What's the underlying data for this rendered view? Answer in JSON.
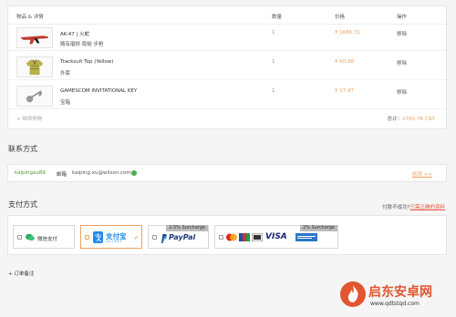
{
  "cart": {
    "headers": {
      "item": "物品 & 详情",
      "qty": "数量",
      "price": "价格",
      "action": "操作"
    },
    "items": [
      {
        "name": "AK-47 | 火蛇",
        "sub": "略有磨损 隐秘 步枪",
        "qty": "1",
        "price": "¥ 1686.31",
        "action": "移除",
        "icon": "ak47-rifle-icon"
      },
      {
        "name": "Tracksuit Top (Yellow)",
        "sub": "外套",
        "qty": "1",
        "price": "¥ 60.98",
        "action": "移除",
        "icon": "tracksuit-icon"
      },
      {
        "name": "GAMESCOM INVITATIONAL KEY",
        "sub": "宝箱",
        "qty": "1",
        "price": "¥ 17.47",
        "action": "移除",
        "icon": "key-icon"
      }
    ],
    "continue": "+ 继续购物",
    "total_label": "总计：",
    "total_amount": "1760.76 CNY"
  },
  "contact": {
    "title": "联系方式",
    "username": "kaipingxu89",
    "mail_label": "邮箱",
    "mail": "kaiping.xu@wilson.com",
    "edit": "修改 >>"
  },
  "payment": {
    "title": "支付方式",
    "note_prefix": "付款不成功?",
    "note_link": "只需正确的资料",
    "methods": [
      {
        "label": "微信支付",
        "icon": "wechat-icon",
        "surcharge": ""
      },
      {
        "label": "支付宝",
        "sub": "ALIPAY",
        "icon": "alipay-icon",
        "surcharge": ""
      },
      {
        "label": "PayPal",
        "icon": "paypal-icon",
        "surcharge": "2.5% Surcharge"
      },
      {
        "label": "VISA",
        "icon": "cards-icon",
        "surcharge": "2% Surcharge"
      }
    ],
    "selected": "支付宝"
  },
  "order_note": "+ 订单备注",
  "watermark": {
    "cn": "启东安卓网",
    "url": "www.qdtstqd.com"
  },
  "colors": {
    "accent": "#f0a060",
    "link": "#e8553e",
    "green": "#4a9a2a",
    "alipay": "#1f8be8",
    "paypal": "#1c3a78"
  }
}
